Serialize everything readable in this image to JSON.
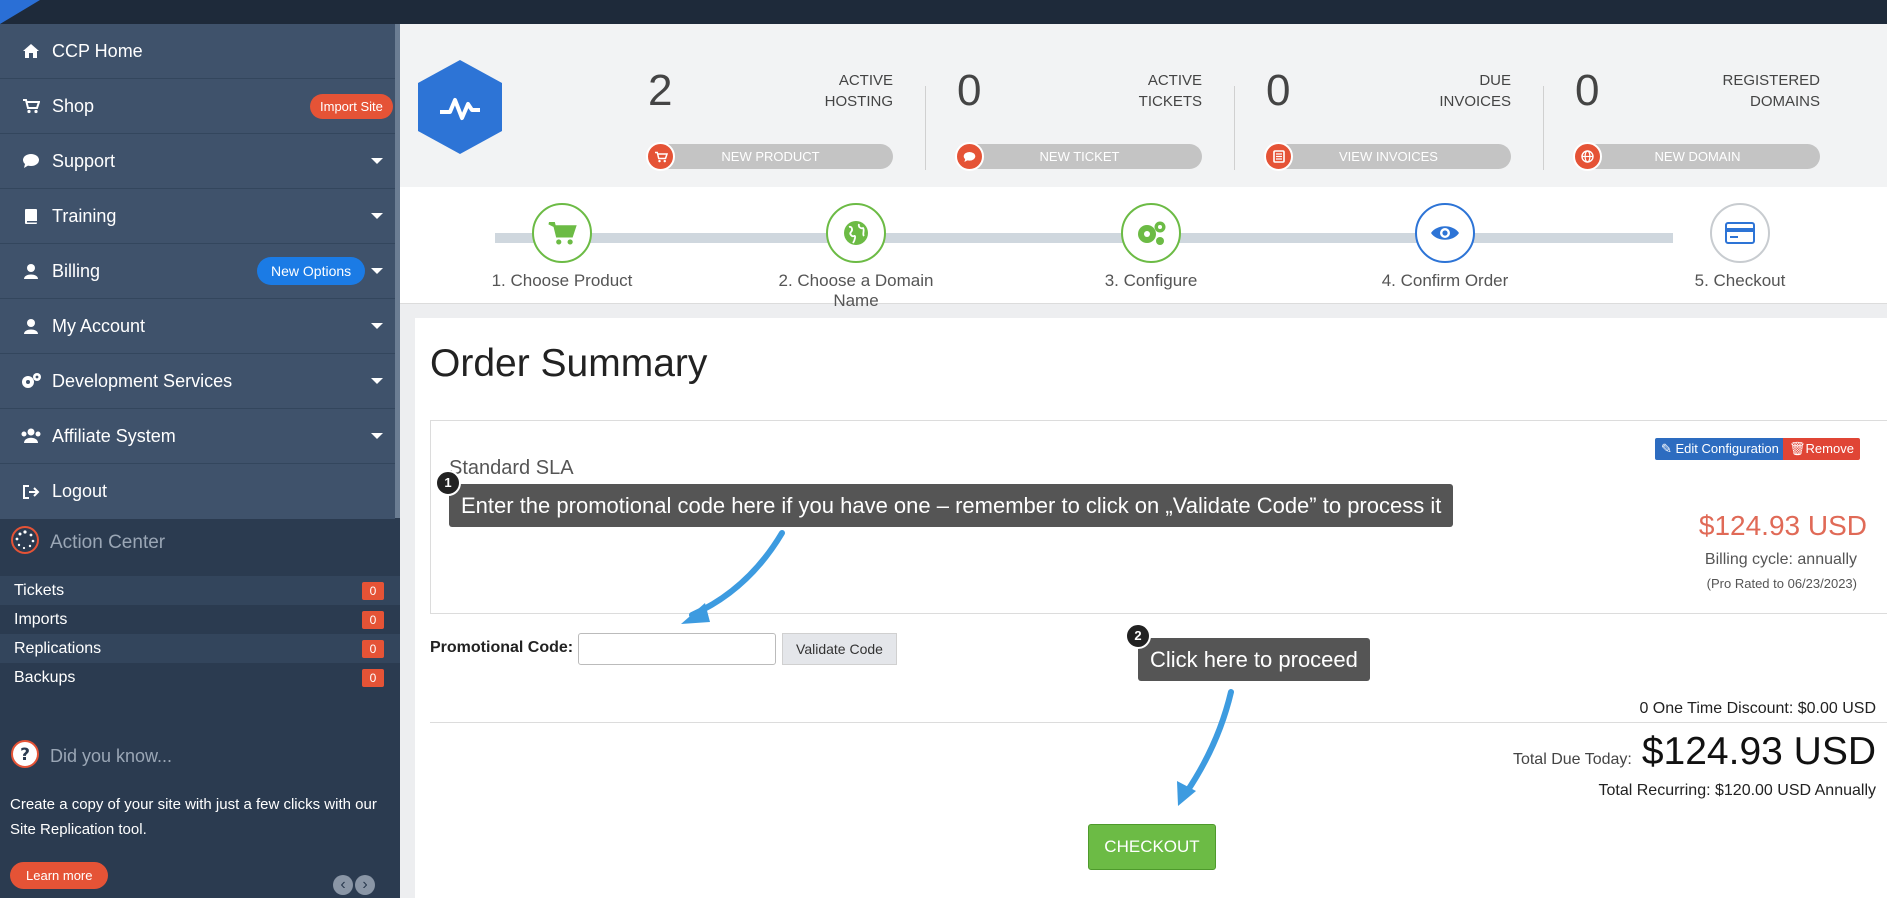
{
  "sidebar": {
    "items": [
      {
        "label": "CCP Home",
        "icon": "home-icon"
      },
      {
        "label": "Shop",
        "icon": "cart-icon",
        "badge": "Import Site"
      },
      {
        "label": "Support",
        "icon": "chat-icon"
      },
      {
        "label": "Training",
        "icon": "book-icon"
      },
      {
        "label": "Billing",
        "icon": "user-icon",
        "badge": "New Options"
      },
      {
        "label": "My Account",
        "icon": "user-icon"
      },
      {
        "label": "Development Services",
        "icon": "gears-icon"
      },
      {
        "label": "Affiliate System",
        "icon": "users-icon"
      },
      {
        "label": "Logout",
        "icon": "logout-icon"
      }
    ],
    "action_center": {
      "title": "Action Center",
      "rows": [
        {
          "label": "Tickets",
          "count": "0"
        },
        {
          "label": "Imports",
          "count": "0"
        },
        {
          "label": "Replications",
          "count": "0"
        },
        {
          "label": "Backups",
          "count": "0"
        }
      ]
    },
    "did_you_know": {
      "title": "Did you know...",
      "text": "Create a copy of your site with just a few clicks with our Site Replication tool.",
      "button": "Learn more"
    }
  },
  "stats": [
    {
      "value": "2",
      "label_line1": "ACTIVE",
      "label_line2": "HOSTING",
      "action": "NEW PRODUCT"
    },
    {
      "value": "0",
      "label_line1": "ACTIVE",
      "label_line2": "TICKETS",
      "action": "NEW TICKET"
    },
    {
      "value": "0",
      "label_line1": "DUE",
      "label_line2": "INVOICES",
      "action": "VIEW INVOICES"
    },
    {
      "value": "0",
      "label_line1": "REGISTERED",
      "label_line2": "DOMAINS",
      "action": "NEW DOMAIN"
    }
  ],
  "steps": [
    {
      "label": "1. Choose Product"
    },
    {
      "label": "2. Choose a Domain Name"
    },
    {
      "label": "3. Configure"
    },
    {
      "label": "4. Confirm Order"
    },
    {
      "label": "5. Checkout"
    }
  ],
  "order": {
    "title": "Order Summary",
    "product_name": "Standard SLA",
    "edit_label": "Edit Configuration",
    "remove_label": "Remove",
    "price": "$124.93 USD",
    "billing_cycle": "Billing cycle: annually",
    "prorated": "(Pro Rated to 06/23/2023)",
    "promo_label": "Promotional Code:",
    "promo_value": "",
    "validate_label": "Validate Code",
    "discount": "0 One Time Discount: $0.00 USD",
    "total_label": "Total Due Today:",
    "total_value": "$124.93 USD",
    "recurring": "Total Recurring: $120.00 USD Annually",
    "checkout_label": "CHECKOUT"
  },
  "callouts": [
    {
      "number": "1",
      "text": "Enter the promotional code here if you have one – remember to click on „Validate Code” to process it"
    },
    {
      "number": "2",
      "text": "Click here to proceed"
    }
  ],
  "colors": {
    "accent_red": "#e55336",
    "accent_blue": "#1b7be5",
    "step_green": "#6cbb45",
    "sidebar_bg": "#3f526b",
    "callout_arrow": "#3d9be0"
  }
}
